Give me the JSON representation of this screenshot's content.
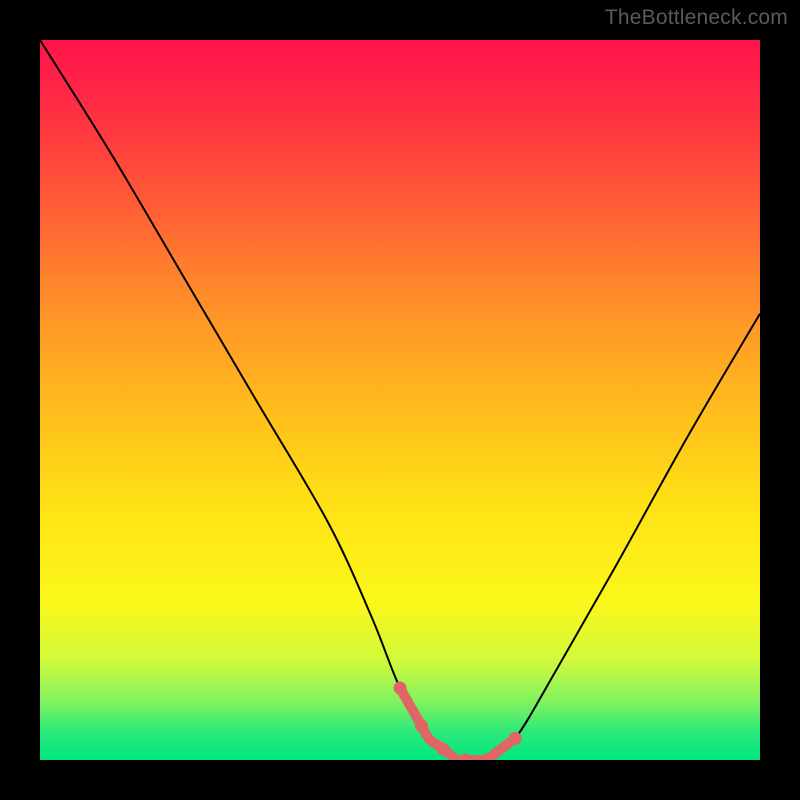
{
  "watermark": "TheBottleneck.com",
  "chart_data": {
    "type": "line",
    "title": "",
    "xlabel": "",
    "ylabel": "",
    "xlim": [
      0,
      100
    ],
    "ylim": [
      0,
      100
    ],
    "series": [
      {
        "name": "curve",
        "x": [
          0,
          10,
          20,
          30,
          40,
          46,
          50,
          54,
          58,
          62,
          66,
          72,
          80,
          90,
          100
        ],
        "values": [
          100,
          84,
          67,
          50,
          33,
          20,
          10,
          3,
          0,
          0,
          3,
          13,
          27,
          45,
          62
        ]
      }
    ],
    "highlight_range_x": [
      50,
      66
    ],
    "highlight_points_x": [
      50,
      53,
      56,
      59,
      62,
      66
    ],
    "colors": {
      "curve": "#000000",
      "highlight": "#e06666",
      "gradient_top": "#ff144a",
      "gradient_bottom": "#00e77f"
    }
  }
}
